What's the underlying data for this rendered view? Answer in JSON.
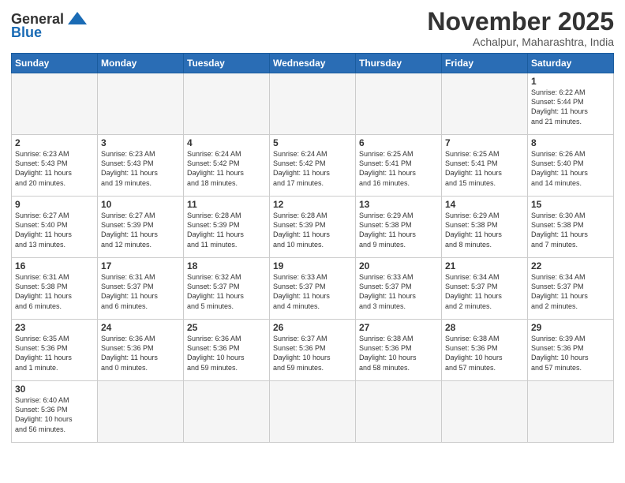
{
  "logo": {
    "general": "General",
    "blue": "Blue"
  },
  "title": {
    "month_year": "November 2025",
    "location": "Achalpur, Maharashtra, India"
  },
  "weekdays": [
    "Sunday",
    "Monday",
    "Tuesday",
    "Wednesday",
    "Thursday",
    "Friday",
    "Saturday"
  ],
  "days": [
    {
      "num": "",
      "info": ""
    },
    {
      "num": "",
      "info": ""
    },
    {
      "num": "",
      "info": ""
    },
    {
      "num": "",
      "info": ""
    },
    {
      "num": "",
      "info": ""
    },
    {
      "num": "",
      "info": ""
    },
    {
      "num": "1",
      "info": "Sunrise: 6:22 AM\nSunset: 5:44 PM\nDaylight: 11 hours\nand 21 minutes."
    },
    {
      "num": "2",
      "info": "Sunrise: 6:23 AM\nSunset: 5:43 PM\nDaylight: 11 hours\nand 20 minutes."
    },
    {
      "num": "3",
      "info": "Sunrise: 6:23 AM\nSunset: 5:43 PM\nDaylight: 11 hours\nand 19 minutes."
    },
    {
      "num": "4",
      "info": "Sunrise: 6:24 AM\nSunset: 5:42 PM\nDaylight: 11 hours\nand 18 minutes."
    },
    {
      "num": "5",
      "info": "Sunrise: 6:24 AM\nSunset: 5:42 PM\nDaylight: 11 hours\nand 17 minutes."
    },
    {
      "num": "6",
      "info": "Sunrise: 6:25 AM\nSunset: 5:41 PM\nDaylight: 11 hours\nand 16 minutes."
    },
    {
      "num": "7",
      "info": "Sunrise: 6:25 AM\nSunset: 5:41 PM\nDaylight: 11 hours\nand 15 minutes."
    },
    {
      "num": "8",
      "info": "Sunrise: 6:26 AM\nSunset: 5:40 PM\nDaylight: 11 hours\nand 14 minutes."
    },
    {
      "num": "9",
      "info": "Sunrise: 6:27 AM\nSunset: 5:40 PM\nDaylight: 11 hours\nand 13 minutes."
    },
    {
      "num": "10",
      "info": "Sunrise: 6:27 AM\nSunset: 5:39 PM\nDaylight: 11 hours\nand 12 minutes."
    },
    {
      "num": "11",
      "info": "Sunrise: 6:28 AM\nSunset: 5:39 PM\nDaylight: 11 hours\nand 11 minutes."
    },
    {
      "num": "12",
      "info": "Sunrise: 6:28 AM\nSunset: 5:39 PM\nDaylight: 11 hours\nand 10 minutes."
    },
    {
      "num": "13",
      "info": "Sunrise: 6:29 AM\nSunset: 5:38 PM\nDaylight: 11 hours\nand 9 minutes."
    },
    {
      "num": "14",
      "info": "Sunrise: 6:29 AM\nSunset: 5:38 PM\nDaylight: 11 hours\nand 8 minutes."
    },
    {
      "num": "15",
      "info": "Sunrise: 6:30 AM\nSunset: 5:38 PM\nDaylight: 11 hours\nand 7 minutes."
    },
    {
      "num": "16",
      "info": "Sunrise: 6:31 AM\nSunset: 5:38 PM\nDaylight: 11 hours\nand 6 minutes."
    },
    {
      "num": "17",
      "info": "Sunrise: 6:31 AM\nSunset: 5:37 PM\nDaylight: 11 hours\nand 6 minutes."
    },
    {
      "num": "18",
      "info": "Sunrise: 6:32 AM\nSunset: 5:37 PM\nDaylight: 11 hours\nand 5 minutes."
    },
    {
      "num": "19",
      "info": "Sunrise: 6:33 AM\nSunset: 5:37 PM\nDaylight: 11 hours\nand 4 minutes."
    },
    {
      "num": "20",
      "info": "Sunrise: 6:33 AM\nSunset: 5:37 PM\nDaylight: 11 hours\nand 3 minutes."
    },
    {
      "num": "21",
      "info": "Sunrise: 6:34 AM\nSunset: 5:37 PM\nDaylight: 11 hours\nand 2 minutes."
    },
    {
      "num": "22",
      "info": "Sunrise: 6:34 AM\nSunset: 5:37 PM\nDaylight: 11 hours\nand 2 minutes."
    },
    {
      "num": "23",
      "info": "Sunrise: 6:35 AM\nSunset: 5:36 PM\nDaylight: 11 hours\nand 1 minute."
    },
    {
      "num": "24",
      "info": "Sunrise: 6:36 AM\nSunset: 5:36 PM\nDaylight: 11 hours\nand 0 minutes."
    },
    {
      "num": "25",
      "info": "Sunrise: 6:36 AM\nSunset: 5:36 PM\nDaylight: 10 hours\nand 59 minutes."
    },
    {
      "num": "26",
      "info": "Sunrise: 6:37 AM\nSunset: 5:36 PM\nDaylight: 10 hours\nand 59 minutes."
    },
    {
      "num": "27",
      "info": "Sunrise: 6:38 AM\nSunset: 5:36 PM\nDaylight: 10 hours\nand 58 minutes."
    },
    {
      "num": "28",
      "info": "Sunrise: 6:38 AM\nSunset: 5:36 PM\nDaylight: 10 hours\nand 57 minutes."
    },
    {
      "num": "29",
      "info": "Sunrise: 6:39 AM\nSunset: 5:36 PM\nDaylight: 10 hours\nand 57 minutes."
    },
    {
      "num": "30",
      "info": "Sunrise: 6:40 AM\nSunset: 5:36 PM\nDaylight: 10 hours\nand 56 minutes."
    },
    {
      "num": "",
      "info": ""
    },
    {
      "num": "",
      "info": ""
    },
    {
      "num": "",
      "info": ""
    },
    {
      "num": "",
      "info": ""
    },
    {
      "num": "",
      "info": ""
    },
    {
      "num": "",
      "info": ""
    }
  ]
}
